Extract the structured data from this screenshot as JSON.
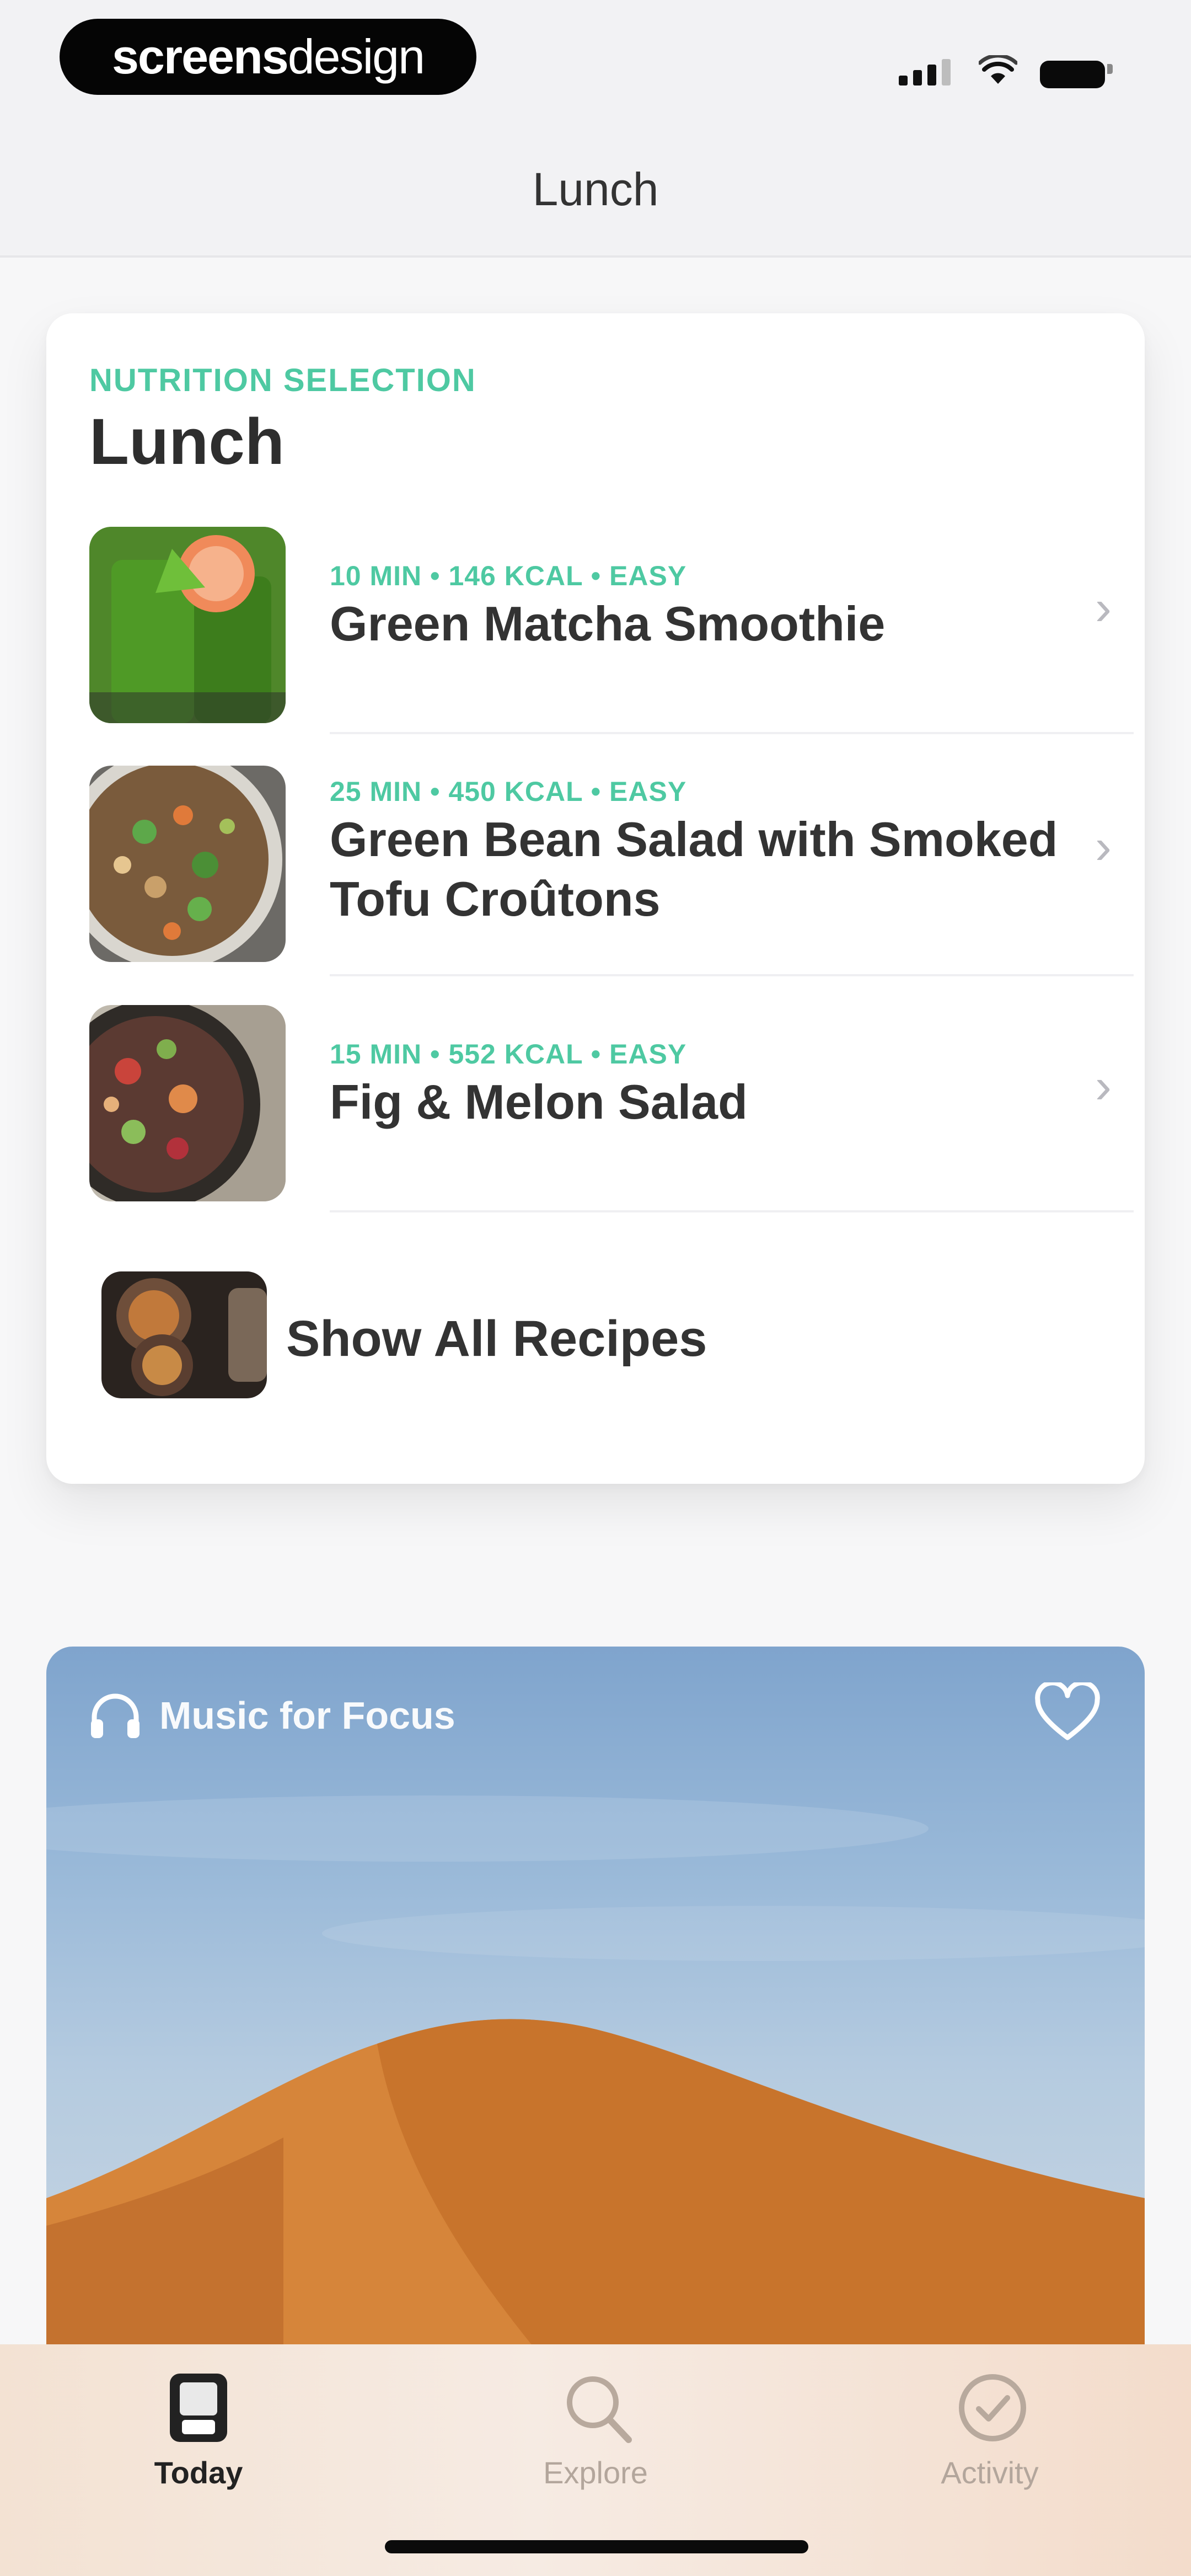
{
  "status_bar": {
    "brand_bold": "screens",
    "brand_light": "design"
  },
  "nav": {
    "title": "Lunch"
  },
  "nutrition": {
    "eyebrow": "NUTRITION SELECTION",
    "title": "Lunch",
    "recipes": [
      {
        "meta": "10 MIN • 146 KCAL • EASY",
        "name": "Green Matcha Smoothie",
        "thumb": "smoothie"
      },
      {
        "meta": "25 MIN • 450 KCAL • EASY",
        "name": "Green Bean Salad with Smoked Tofu Croûtons",
        "thumb": "salad-bowl"
      },
      {
        "meta": "15 MIN • 552 KCAL • EASY",
        "name": "Fig & Melon Salad",
        "thumb": "fig-salad"
      }
    ],
    "show_all": "Show All Recipes"
  },
  "music": {
    "label": "Music for Focus",
    "icon": "headphones-icon",
    "favorite_icon": "heart-icon"
  },
  "tabs": [
    {
      "label": "Today",
      "icon": "today-icon",
      "active": true
    },
    {
      "label": "Explore",
      "icon": "search-icon",
      "active": false
    },
    {
      "label": "Activity",
      "icon": "check-circle-icon",
      "active": false
    }
  ],
  "colors": {
    "accent": "#4ec9a2",
    "tab_bar": "#f4e6da",
    "sand": "#d88638",
    "sky": "#98b8d8"
  }
}
